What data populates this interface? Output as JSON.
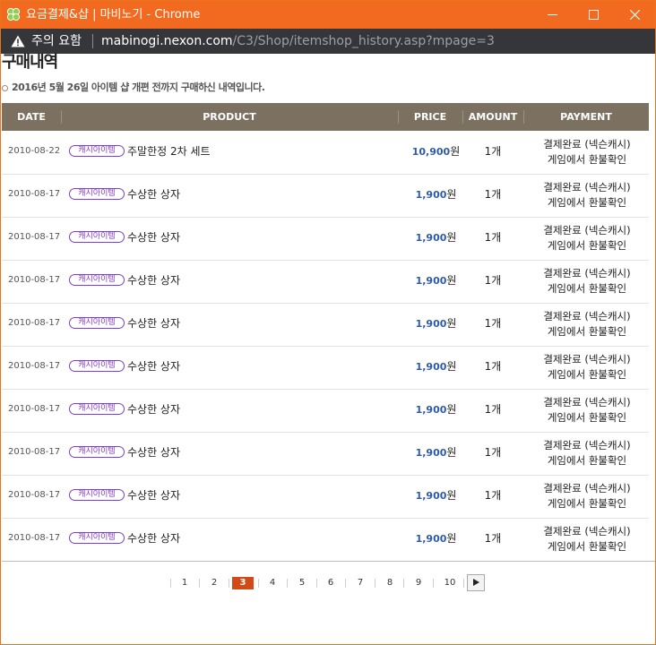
{
  "window": {
    "title": "요금결제&샵 | 마비노기 - Chrome"
  },
  "address_bar": {
    "security_label": "주의 요함",
    "url_host": "mabinogi.nexon.com",
    "url_path": "/C3/Shop/itemshop_history.asp?mpage=3"
  },
  "page": {
    "title": "구매내역",
    "subtitle": "2016년 5월 26일 아이템 샵 개편 전까지 구매하신 내역입니다."
  },
  "table": {
    "headers": {
      "date": "DATE",
      "product": "PRODUCT",
      "price": "PRICE",
      "amount": "AMOUNT",
      "payment": "PAYMENT"
    },
    "rows": [
      {
        "date": "2010-08-22",
        "badge": "캐시아이템",
        "product": "주말한정 2차 세트",
        "price": "10,900",
        "currency": "원",
        "amount": "1개",
        "payment_status": "결제완료 (넥슨캐시)",
        "payment_note": "게임에서 환불확인"
      },
      {
        "date": "2010-08-17",
        "badge": "캐시아이템",
        "product": "수상한 상자",
        "price": "1,900",
        "currency": "원",
        "amount": "1개",
        "payment_status": "결제완료 (넥슨캐시)",
        "payment_note": "게임에서 환불확인"
      },
      {
        "date": "2010-08-17",
        "badge": "캐시아이템",
        "product": "수상한 상자",
        "price": "1,900",
        "currency": "원",
        "amount": "1개",
        "payment_status": "결제완료 (넥슨캐시)",
        "payment_note": "게임에서 환불확인"
      },
      {
        "date": "2010-08-17",
        "badge": "캐시아이템",
        "product": "수상한 상자",
        "price": "1,900",
        "currency": "원",
        "amount": "1개",
        "payment_status": "결제완료 (넥슨캐시)",
        "payment_note": "게임에서 환불확인"
      },
      {
        "date": "2010-08-17",
        "badge": "캐시아이템",
        "product": "수상한 상자",
        "price": "1,900",
        "currency": "원",
        "amount": "1개",
        "payment_status": "결제완료 (넥슨캐시)",
        "payment_note": "게임에서 환불확인"
      },
      {
        "date": "2010-08-17",
        "badge": "캐시아이템",
        "product": "수상한 상자",
        "price": "1,900",
        "currency": "원",
        "amount": "1개",
        "payment_status": "결제완료 (넥슨캐시)",
        "payment_note": "게임에서 환불확인"
      },
      {
        "date": "2010-08-17",
        "badge": "캐시아이템",
        "product": "수상한 상자",
        "price": "1,900",
        "currency": "원",
        "amount": "1개",
        "payment_status": "결제완료 (넥슨캐시)",
        "payment_note": "게임에서 환불확인"
      },
      {
        "date": "2010-08-17",
        "badge": "캐시아이템",
        "product": "수상한 상자",
        "price": "1,900",
        "currency": "원",
        "amount": "1개",
        "payment_status": "결제완료 (넥슨캐시)",
        "payment_note": "게임에서 환불확인"
      },
      {
        "date": "2010-08-17",
        "badge": "캐시아이템",
        "product": "수상한 상자",
        "price": "1,900",
        "currency": "원",
        "amount": "1개",
        "payment_status": "결제완료 (넥슨캐시)",
        "payment_note": "게임에서 환불확인"
      },
      {
        "date": "2010-08-17",
        "badge": "캐시아이템",
        "product": "수상한 상자",
        "price": "1,900",
        "currency": "원",
        "amount": "1개",
        "payment_status": "결제완료 (넥슨캐시)",
        "payment_note": "게임에서 환불확인"
      }
    ]
  },
  "pagination": {
    "pages": [
      "1",
      "2",
      "3",
      "4",
      "5",
      "6",
      "7",
      "8",
      "9",
      "10"
    ],
    "current": "3",
    "next_icon": "play-arrow-icon"
  },
  "colors": {
    "titlebar": "#f16a1f",
    "addressbar": "#35363a",
    "table_header": "#7c7160",
    "badge": "#7f3fc4",
    "price": "#2e5aa8",
    "current_page": "#d24a17"
  }
}
